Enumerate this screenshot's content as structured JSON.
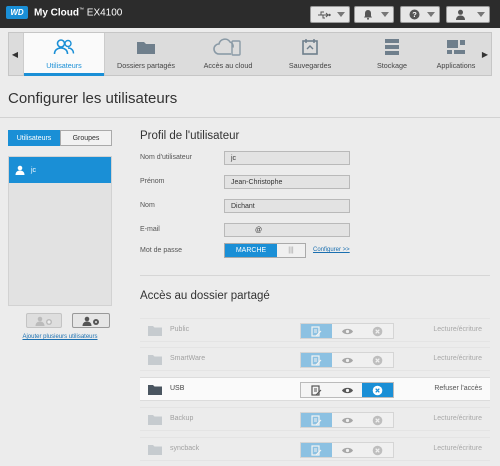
{
  "header": {
    "logo": "WD",
    "product_prefix": "My Cloud",
    "product_mark": "™",
    "product_model": "EX4100",
    "buttons": [
      {
        "icon": "usb-icon"
      },
      {
        "icon": "bell-icon"
      },
      {
        "icon": "help-icon"
      },
      {
        "icon": "user-icon"
      }
    ]
  },
  "nav": {
    "tabs": [
      {
        "label": "Utilisateurs",
        "icon": "users-icon",
        "active": true
      },
      {
        "label": "Dossiers partagés",
        "icon": "folder-icon",
        "active": false
      },
      {
        "label": "Accès au cloud",
        "icon": "cloud-icon",
        "active": false
      },
      {
        "label": "Sauvegardes",
        "icon": "backup-icon",
        "active": false
      },
      {
        "label": "Stockage",
        "icon": "storage-icon",
        "active": false
      },
      {
        "label": "Applications",
        "icon": "apps-icon",
        "active": false
      }
    ]
  },
  "page_title": "Configurer les utilisateurs",
  "left": {
    "seg_users": "Utilisateurs",
    "seg_groups": "Groupes",
    "users": [
      {
        "name": "jc",
        "selected": true
      }
    ],
    "add_multiple": "Ajouter plusieurs utilisateurs"
  },
  "profile": {
    "title": "Profil de l'utilisateur",
    "username_label": "Nom d'utilisateur",
    "username_value": "jc",
    "firstname_label": "Prénom",
    "firstname_value": "Jean-Christophe",
    "lastname_label": "Nom",
    "lastname_value": "Dichant",
    "email_label": "E-mail",
    "email_value": "@",
    "password_label": "Mot de passe",
    "password_toggle": "MARCHE",
    "toggle_grip": "|||",
    "configure_link": "Configurer >>"
  },
  "shares": {
    "title": "Accès au dossier partagé",
    "rows": [
      {
        "name": "Public",
        "status": "Lecture/écriture",
        "perm": "rw",
        "dim": true
      },
      {
        "name": "SmartWare",
        "status": "Lecture/écriture",
        "perm": "rw",
        "dim": true
      },
      {
        "name": "USB",
        "status": "Refuser l'accès",
        "perm": "deny",
        "dim": false
      },
      {
        "name": "Backup",
        "status": "Lecture/écriture",
        "perm": "rw",
        "dim": true
      },
      {
        "name": "syncback",
        "status": "Lecture/écriture",
        "perm": "rw",
        "dim": true
      }
    ]
  },
  "colors": {
    "accent": "#1a8fd6",
    "topbar": "#2c2c2c",
    "background": "#ececec"
  }
}
